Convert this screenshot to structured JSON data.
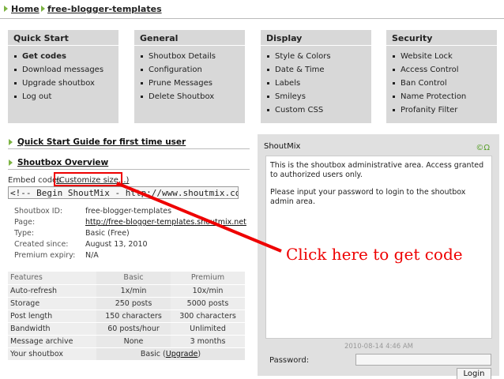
{
  "breadcrumb": {
    "home": "Home",
    "current": "free-blogger-templates"
  },
  "panels": [
    {
      "title": "Quick Start",
      "items": [
        "Get codes",
        "Download messages",
        "Upgrade shoutbox",
        "Log out"
      ]
    },
    {
      "title": "General",
      "items": [
        "Shoutbox Details",
        "Configuration",
        "Prune Messages",
        "Delete Shoutbox"
      ]
    },
    {
      "title": "Display",
      "items": [
        "Style & Colors",
        "Date & Time",
        "Labels",
        "Smileys",
        "Custom CSS"
      ]
    },
    {
      "title": "Security",
      "items": [
        "Website Lock",
        "Access Control",
        "Ban Control",
        "Name Protection",
        "Profanity Filter"
      ]
    }
  ],
  "bars": {
    "guide": "Quick Start Guide for first time user",
    "overview": "Shoutbox Overview"
  },
  "embed": {
    "label": "Embed codes",
    "customize": "(Customize size...)",
    "code": "<!-- Begin ShoutMix - http://www.shoutmix.com -->"
  },
  "info": [
    {
      "key": "Shoutbox ID:",
      "value": "free-blogger-templates"
    },
    {
      "key": "Page:",
      "value": "http://free-blogger-templates.shoutmix.net"
    },
    {
      "key": "Type:",
      "value": "Basic (Free)"
    },
    {
      "key": "Created since:",
      "value": "August 13, 2010"
    },
    {
      "key": "Premium expiry:",
      "value": "N/A"
    }
  ],
  "features": {
    "headers": [
      "Features",
      "Basic",
      "Premium"
    ],
    "rows": [
      [
        "Auto-refresh",
        "1x/min",
        "10x/min"
      ],
      [
        "Storage",
        "250 posts",
        "5000 posts"
      ],
      [
        "Post length",
        "150 characters",
        "300 characters"
      ],
      [
        "Bandwidth",
        "60 posts/hour",
        "Unlimited"
      ],
      [
        "Message archive",
        "None",
        "3 months"
      ]
    ],
    "your_label": "Your shoutbox",
    "your_value_pre": "Basic (",
    "your_value_link": "Upgrade",
    "your_value_post": ")"
  },
  "shoutbox": {
    "title": "ShoutMix",
    "message1": "This is the shoutbox administrative area. Access granted to authorized users only.",
    "message2": "Please input your password to login to the shoutbox admin area.",
    "timestamp": "2010-08-14 4:46 AM",
    "password_label": "Password:",
    "login_label": "Login"
  },
  "callout": "Click here to get code",
  "colors": {
    "panel_bg": "#d8d8d8",
    "accent_green": "#7cb342",
    "callout_red": "#ee0000"
  }
}
